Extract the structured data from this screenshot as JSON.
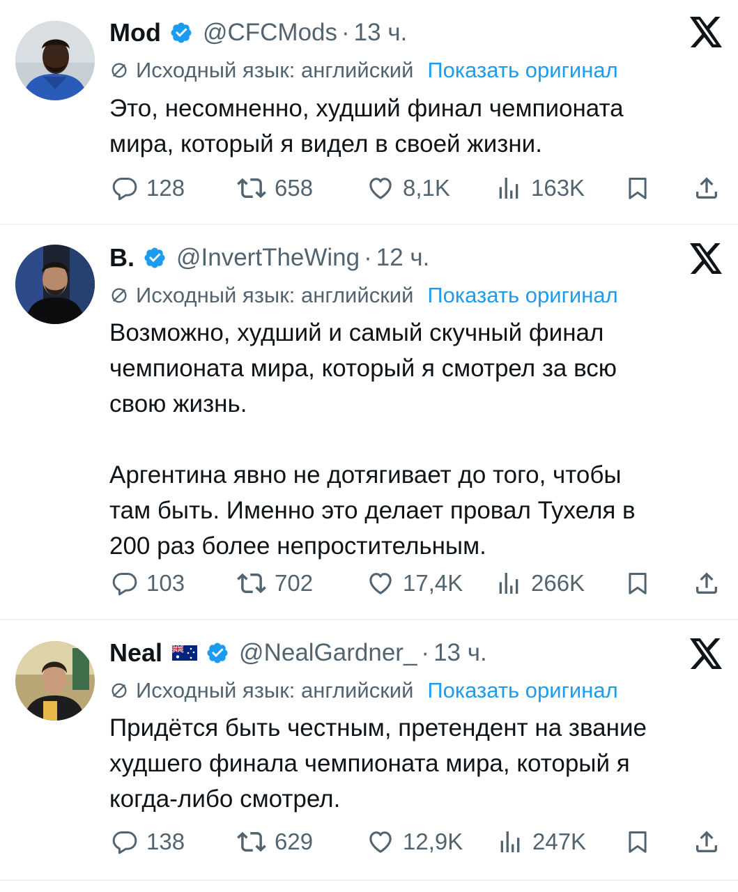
{
  "tweets": [
    {
      "name": "Mod",
      "handle": "@CFCMods",
      "separator": "·",
      "time": "13 ч.",
      "translation_label": "Исходный язык: английский",
      "show_original": "Показать оригинал",
      "lines": [
        "Это, несомненно, худший финал чемпионата",
        "мира, который я видел в своей жизни."
      ],
      "replies": "128",
      "retweets": "658",
      "likes": "8,1K",
      "views": "163K"
    },
    {
      "name": "B.",
      "handle": "@InvertTheWing",
      "separator": "·",
      "time": "12 ч.",
      "translation_label": "Исходный язык: английский",
      "show_original": "Показать оригинал",
      "lines": [
        "Возможно, худший и самый скучный финал",
        "чемпионата мира, который я смотрел за всю",
        "свою жизнь."
      ],
      "lines2": [
        "Аргентина явно не дотягивает до того, чтобы",
        "там быть. Именно это делает провал Тухеля в",
        "200 раз более непростительным."
      ],
      "replies": "103",
      "retweets": "702",
      "likes": "17,4K",
      "views": "266K"
    },
    {
      "name": "Neal",
      "handle": "@NealGardner_",
      "separator": "·",
      "time": "13 ч.",
      "translation_label": "Исходный язык: английский",
      "show_original": "Показать оригинал",
      "lines": [
        "Придётся быть честным, претендент на звание",
        "худшего финала чемпионата мира, который я",
        "когда-либо смотрел."
      ],
      "replies": "138",
      "retweets": "629",
      "likes": "12,9K",
      "views": "247K"
    }
  ],
  "icons": {
    "verified": "verified-badge-icon",
    "flag": "australia-flag-icon",
    "platform": "x-logo-icon",
    "translate": "translate-icon",
    "reply": "reply-icon",
    "retweet": "retweet-icon",
    "like": "heart-icon",
    "views": "views-icon",
    "bookmark": "bookmark-icon",
    "share": "share-icon"
  },
  "colors": {
    "link": "#1d9bf0",
    "secondary_text": "#536471",
    "verified": "#1d9bf0"
  }
}
